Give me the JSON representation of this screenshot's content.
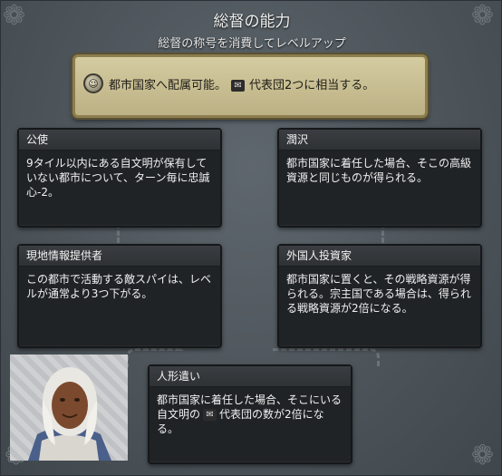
{
  "header": {
    "title": "総督の能力",
    "subtitle": "総督の称号を消費してレベルアップ"
  },
  "banner": {
    "icon": "governor-portrait-icon",
    "text_before": "都市国家へ配属可能。",
    "delegate_icon": "delegate-icon",
    "text_after": "代表団2つに相当する。"
  },
  "cards": {
    "kouishi": {
      "title": "公使",
      "body": "9タイル以内にある自文明が保有していない都市について、ターン毎に忠誠心-2。"
    },
    "junataku": {
      "title": "潤沢",
      "body": "都市国家に着任した場合、そこの高級資源と同じものが得られる。"
    },
    "genchi": {
      "title": "現地情報提供者",
      "body": "この都市で活動する敵スパイは、レベルが通常より3つ下がる。"
    },
    "gaikoku": {
      "title": "外国人投資家",
      "body": "都市国家に置くと、その戦略資源が得られる。宗主国である場合は、得られる戦略資源が2倍になる。"
    },
    "ningyou": {
      "title": "人形遣い",
      "body_before": "都市国家に着任した場合、そこにいる自文明の",
      "delegate_icon": "delegate-icon",
      "body_after": "代表団の数が2倍になる。"
    }
  },
  "portrait": {
    "icon": "governor-portrait"
  },
  "colors": {
    "banner_bg": "#c9bf94",
    "card_bg": "#202326",
    "panel_bg": "#525a60"
  }
}
